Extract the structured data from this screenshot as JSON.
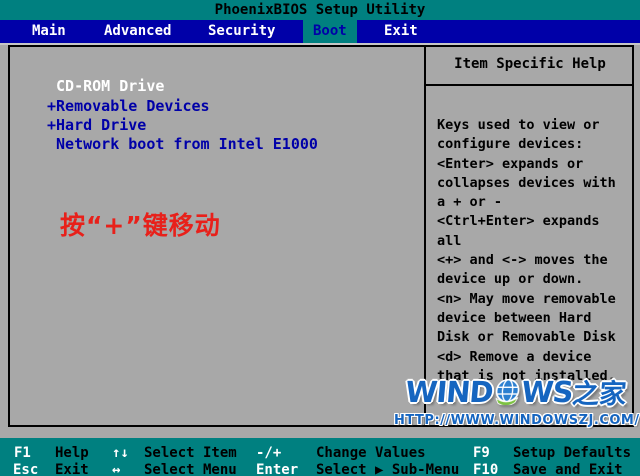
{
  "title_bar": {
    "title": "PhoenixBIOS Setup Utility"
  },
  "menu": {
    "items": [
      {
        "label": "Main",
        "selected": false
      },
      {
        "label": "Advanced",
        "selected": false
      },
      {
        "label": "Security",
        "selected": false
      },
      {
        "label": "Boot",
        "selected": true
      },
      {
        "label": "Exit",
        "selected": false
      }
    ]
  },
  "boot_list": {
    "items": [
      {
        "prefix": " ",
        "label": "CD-ROM Drive",
        "selected": true
      },
      {
        "prefix": "+",
        "label": "Removable Devices",
        "selected": false
      },
      {
        "prefix": "+",
        "label": "Hard Drive",
        "selected": false
      },
      {
        "prefix": " ",
        "label": "Network boot from Intel E1000",
        "selected": false
      }
    ],
    "annotation": "按“+”键移动"
  },
  "help_panel": {
    "title": "Item Specific Help",
    "lines": "Keys used to view or\nconfigure devices:\n<Enter> expands or\ncollapses devices with\na + or -\n<Ctrl+Enter> expands\nall\n<+> and <-> moves the\ndevice up or down.\n<n> May move removable\ndevice between Hard\nDisk or Removable Disk\n<d> Remove a device\nthat is not installed."
  },
  "watermark": {
    "brand_pre": "WIND",
    "brand_post": "WS",
    "brand_cn": "之家",
    "url": "HTTP://WWW.WINDOWSZJ.COM/"
  },
  "footer": {
    "row1": [
      {
        "key": "F1",
        "label": "Help"
      },
      {
        "key": "↑↓",
        "label": "Select Item"
      },
      {
        "key": "-/+",
        "label": "Change Values"
      },
      {
        "key": "F9",
        "label": "Setup Defaults"
      }
    ],
    "row2": [
      {
        "key": "Esc",
        "label": "Exit"
      },
      {
        "key": "↔",
        "label": "Select Menu"
      },
      {
        "key": "Enter",
        "label": "Select ▶ Sub-Menu"
      },
      {
        "key": "F10",
        "label": "Save and Exit"
      }
    ]
  },
  "colors": {
    "teal": "#008080",
    "menu_blue": "#0000a8",
    "content_gray": "#a8a8a8",
    "item_blue": "#0000a8",
    "selected_item_white": "#ffffff",
    "annotation_red": "#e8201a",
    "brand_blue": "#1565c0"
  }
}
